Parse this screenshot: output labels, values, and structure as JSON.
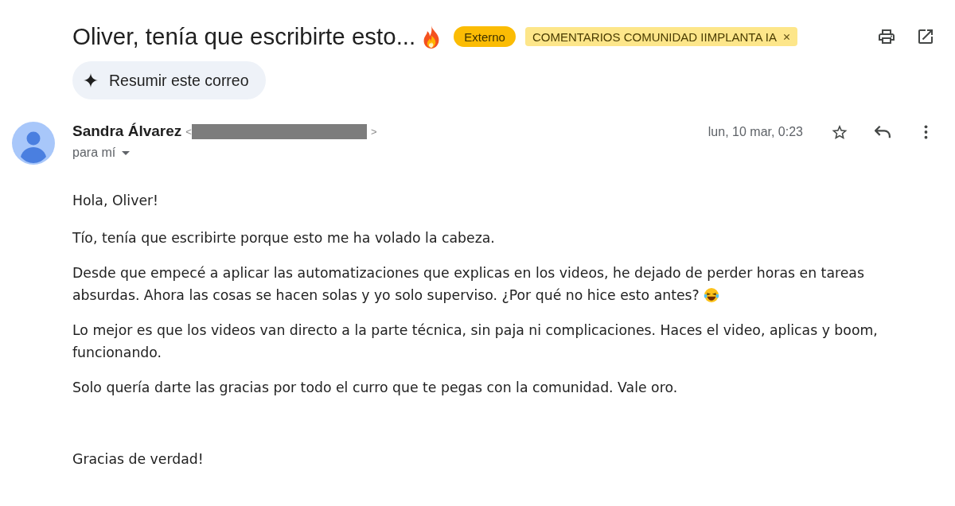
{
  "subject": {
    "title": "Oliver, tenía que escribirte esto...",
    "trailing_icon": {
      "kind": "fire"
    },
    "labels": [
      {
        "text": "Externo",
        "color": "#fbbc04",
        "removable": false
      },
      {
        "text": "COMENTARIOS COMUNIDAD IIMPLANTA IA",
        "color": "#fde68a",
        "removable": true
      }
    ]
  },
  "summary_button": {
    "label": "Resumir este correo"
  },
  "message": {
    "sender": {
      "name": "Sandra Álvarez",
      "email_open": "<",
      "email_redacted": true,
      "email_close": ">"
    },
    "recipient": "para mí",
    "date": "lun, 10 mar, 0:23",
    "starred": false
  },
  "body": {
    "paragraphs": [
      {
        "text": "Hola, Oliver!"
      },
      {
        "text": "Tío, tenía que escribirte porque esto me ha volado la cabeza."
      },
      {
        "text": "Desde que empecé a aplicar las automatizaciones que explicas en los videos, he dejado de perder horas en tareas absurdas. Ahora las cosas se hacen solas y yo solo superviso. ¿Por qué no hice esto antes?",
        "trailing_icon": {
          "kind": "laughing"
        }
      },
      {
        "text": "Lo mejor es que los videos van directo a la parte técnica, sin paja ni complicaciones. Haces el video, aplicas y boom, funcionando."
      },
      {
        "text": "Solo quería darte las gracias por todo el curro que te pegas con la comunidad. Vale oro."
      }
    ],
    "closing": "Gracias de verdad!"
  }
}
